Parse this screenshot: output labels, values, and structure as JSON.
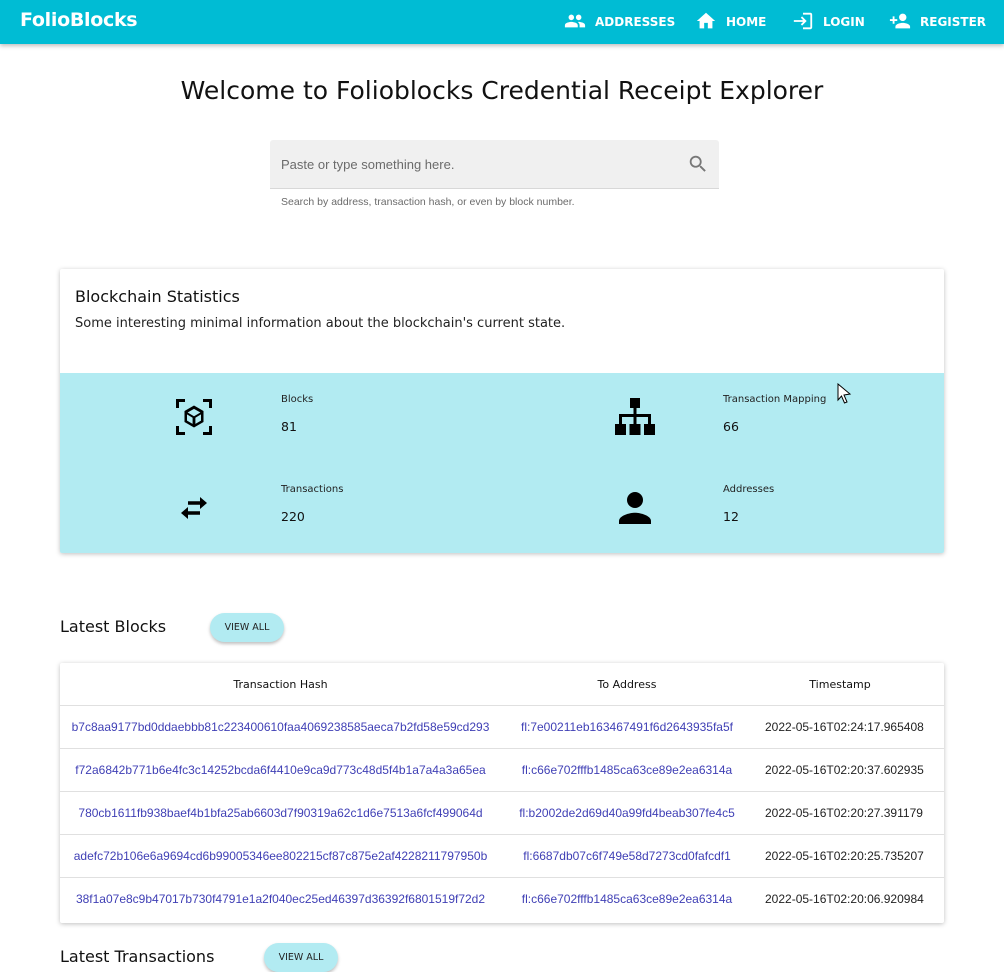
{
  "navbar": {
    "brand": "FolioBlocks",
    "items": [
      {
        "label": "ADDRESSES",
        "icon": "people-icon"
      },
      {
        "label": "HOME",
        "icon": "home-icon"
      },
      {
        "label": "LOGIN",
        "icon": "login-icon"
      },
      {
        "label": "REGISTER",
        "icon": "person-add-icon"
      }
    ]
  },
  "page": {
    "title": "Welcome to Folioblocks Credential Receipt Explorer"
  },
  "search": {
    "placeholder": "Paste or type something here.",
    "value": "",
    "helper": "Search by address, transaction hash, or even by block number."
  },
  "stats": {
    "title": "Blockchain Statistics",
    "subtitle": "Some interesting minimal information about the blockchain's current state.",
    "items": [
      {
        "label": "Blocks",
        "value": "81",
        "icon": "cube-scan-icon"
      },
      {
        "label": "Transaction Mapping",
        "value": "66",
        "icon": "sitemap-icon"
      },
      {
        "label": "Transactions",
        "value": "220",
        "icon": "swap-arrows-icon"
      },
      {
        "label": "Addresses",
        "value": "12",
        "icon": "person-icon"
      }
    ]
  },
  "latest_blocks": {
    "title": "Latest Blocks",
    "view_all": "VIEW ALL",
    "columns": [
      "Transaction Hash",
      "To Address",
      "Timestamp"
    ],
    "rows": [
      {
        "hash": "b7c8aa9177bd0ddaebbb81c223400610faa4069238585aeca7b2fd58e59cd293",
        "to": "fl:7e00211eb163467491f6d2643935fa5f",
        "time": "2022-05-16T02:24:17.965408"
      },
      {
        "hash": "f72a6842b771b6e4fc3c14252bcda6f4410e9ca9d773c48d5f4b1a7a4a3a65ea",
        "to": "fl:c66e702fffb1485ca63ce89e2ea6314a",
        "time": "2022-05-16T02:20:37.602935"
      },
      {
        "hash": "780cb1611fb938baef4b1bfa25ab6603d7f90319a62c1d6e7513a6fcf499064d",
        "to": "fl:b2002de2d69d40a99fd4beab307fe4c5",
        "time": "2022-05-16T02:20:27.391179"
      },
      {
        "hash": "adefc72b106e6a9694cd6b99005346ee802215cf87c875e2af4228211797950b",
        "to": "fl:6687db07c6f749e58d7273cd0fafcdf1",
        "time": "2022-05-16T02:20:25.735207"
      },
      {
        "hash": "38f1a07e8c9b47017b730f4791e1a2f040ec25ed46397d36392f6801519f72d2",
        "to": "fl:c66e702fffb1485ca63ce89e2ea6314a",
        "time": "2022-05-16T02:20:06.920984"
      }
    ]
  },
  "latest_transactions": {
    "title": "Latest Transactions",
    "view_all": "VIEW ALL"
  }
}
